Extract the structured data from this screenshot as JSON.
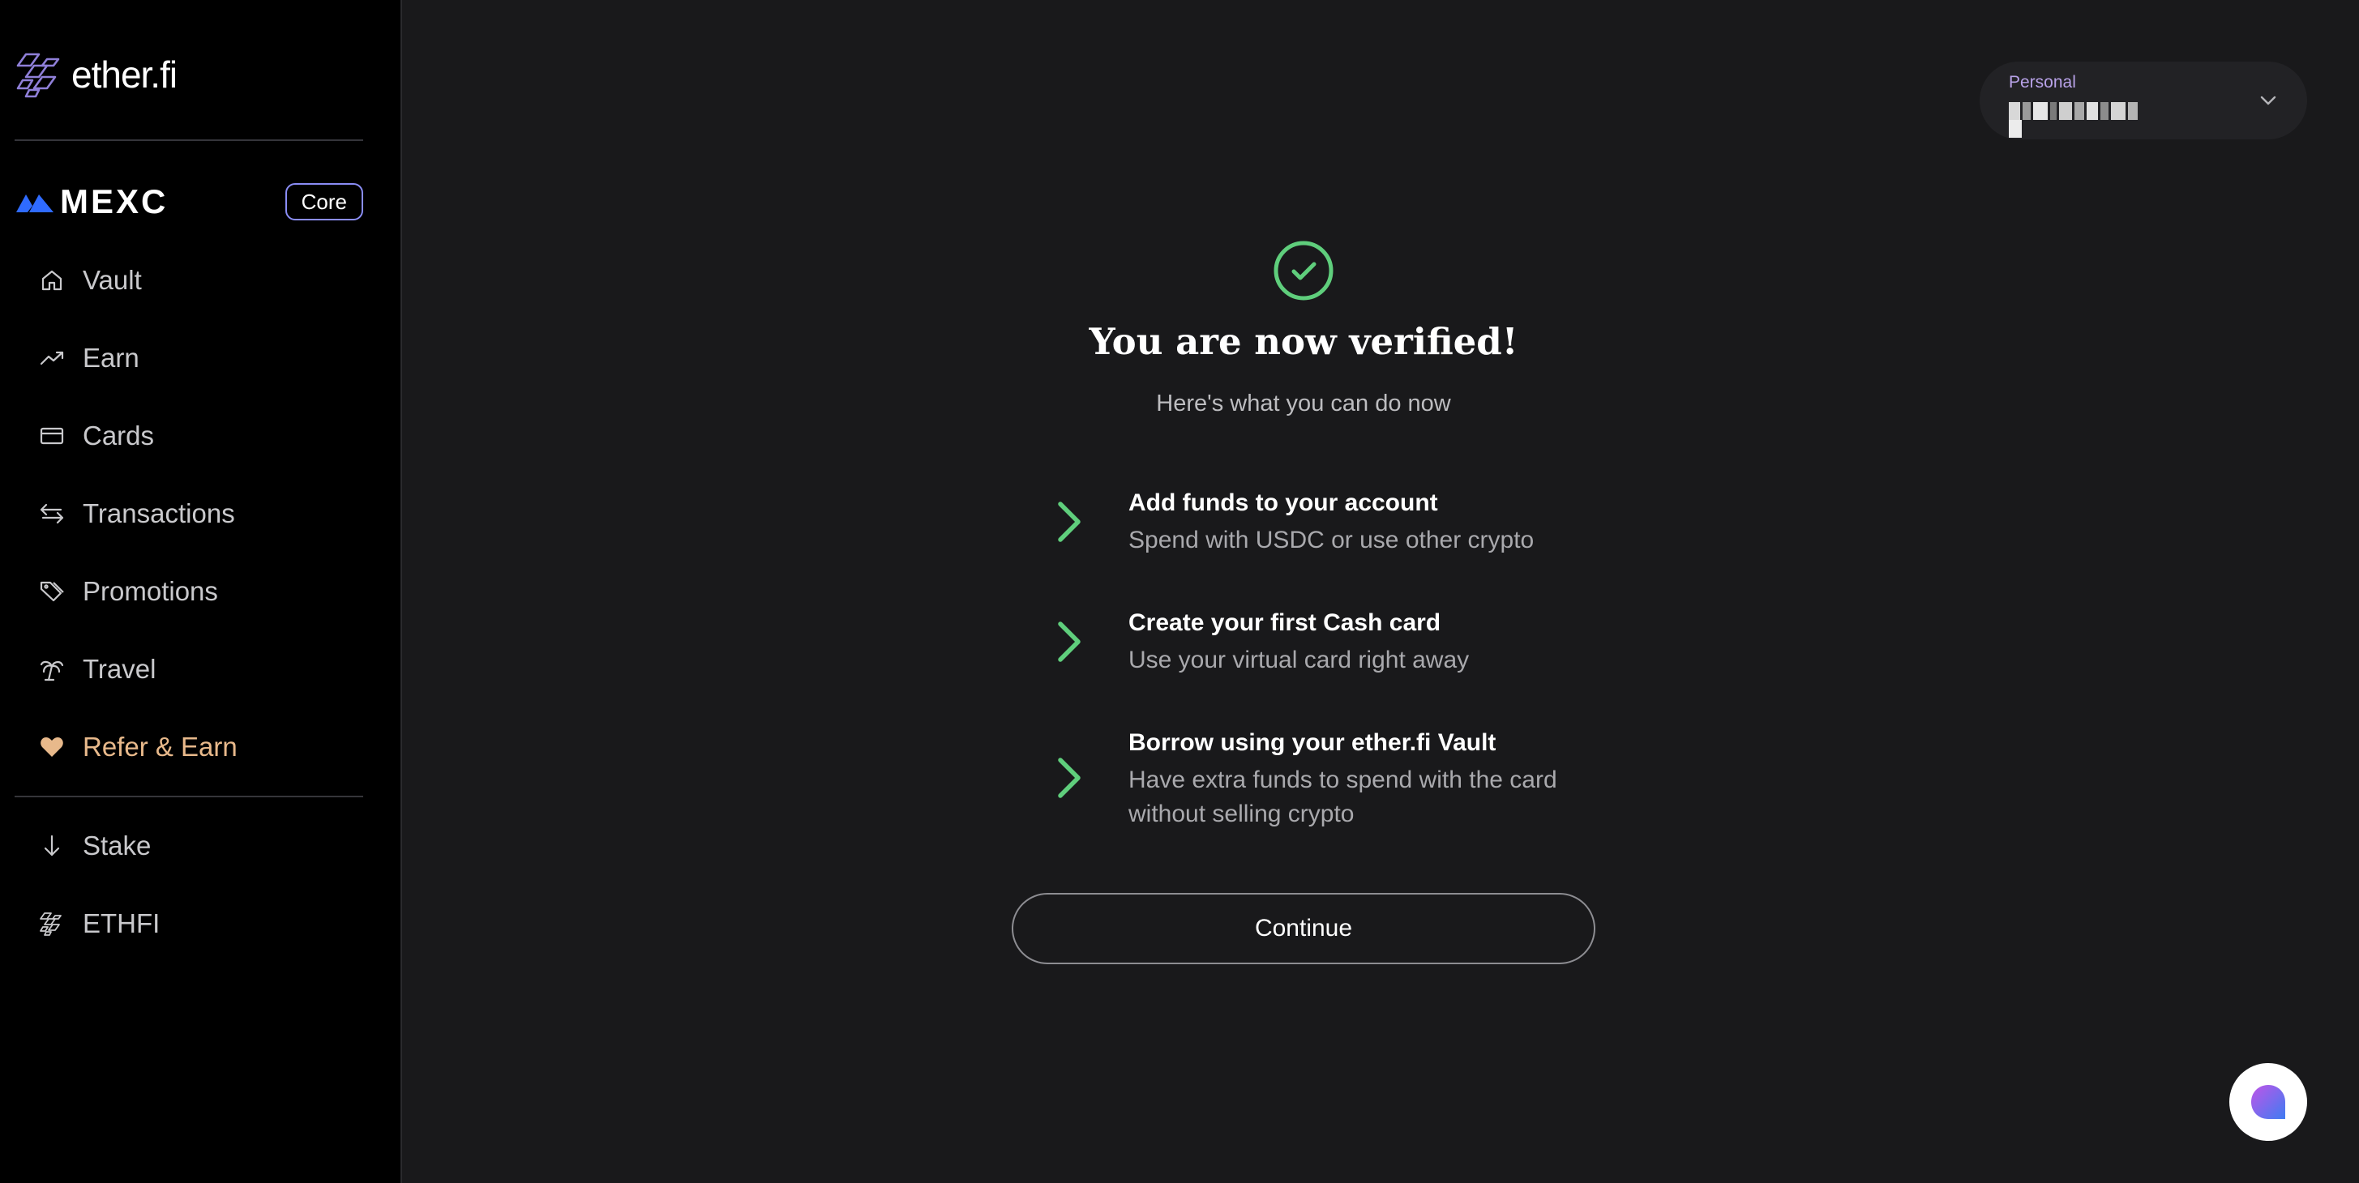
{
  "brand": {
    "name": "ether.fi",
    "icon": "etherfi-logo-icon"
  },
  "partner": {
    "name": "MEXC",
    "badge": "Core",
    "icon": "mexc-logo-icon"
  },
  "sidebar": {
    "items": [
      {
        "label": "Vault",
        "icon": "home-icon"
      },
      {
        "label": "Earn",
        "icon": "trending-up-icon"
      },
      {
        "label": "Cards",
        "icon": "credit-card-icon"
      },
      {
        "label": "Transactions",
        "icon": "swap-arrows-icon"
      },
      {
        "label": "Promotions",
        "icon": "tags-icon"
      },
      {
        "label": "Travel",
        "icon": "palm-tree-icon"
      },
      {
        "label": "Refer & Earn",
        "icon": "heart-icon",
        "accent": "#e8b98b"
      }
    ],
    "secondary_items": [
      {
        "label": "Stake",
        "icon": "arrow-down-icon"
      },
      {
        "label": "ETHFI",
        "icon": "etherfi-logo-icon"
      }
    ]
  },
  "account": {
    "label": "Personal",
    "value_obscured": true,
    "icon": "chevron-down-icon"
  },
  "verification": {
    "title": "You are now verified!",
    "subtitle": "Here's what you can do now",
    "accent": "#5fce7c",
    "steps": [
      {
        "title": "Add funds to your account",
        "desc": "Spend with USDC or use other crypto"
      },
      {
        "title": "Create your first Cash card",
        "desc": "Use your virtual card right away"
      },
      {
        "title": "Borrow using your ether.fi Vault",
        "desc": "Have extra funds to spend with the card without selling crypto"
      }
    ],
    "continue_label": "Continue"
  },
  "support": {
    "icon": "chat-bubble-icon"
  }
}
